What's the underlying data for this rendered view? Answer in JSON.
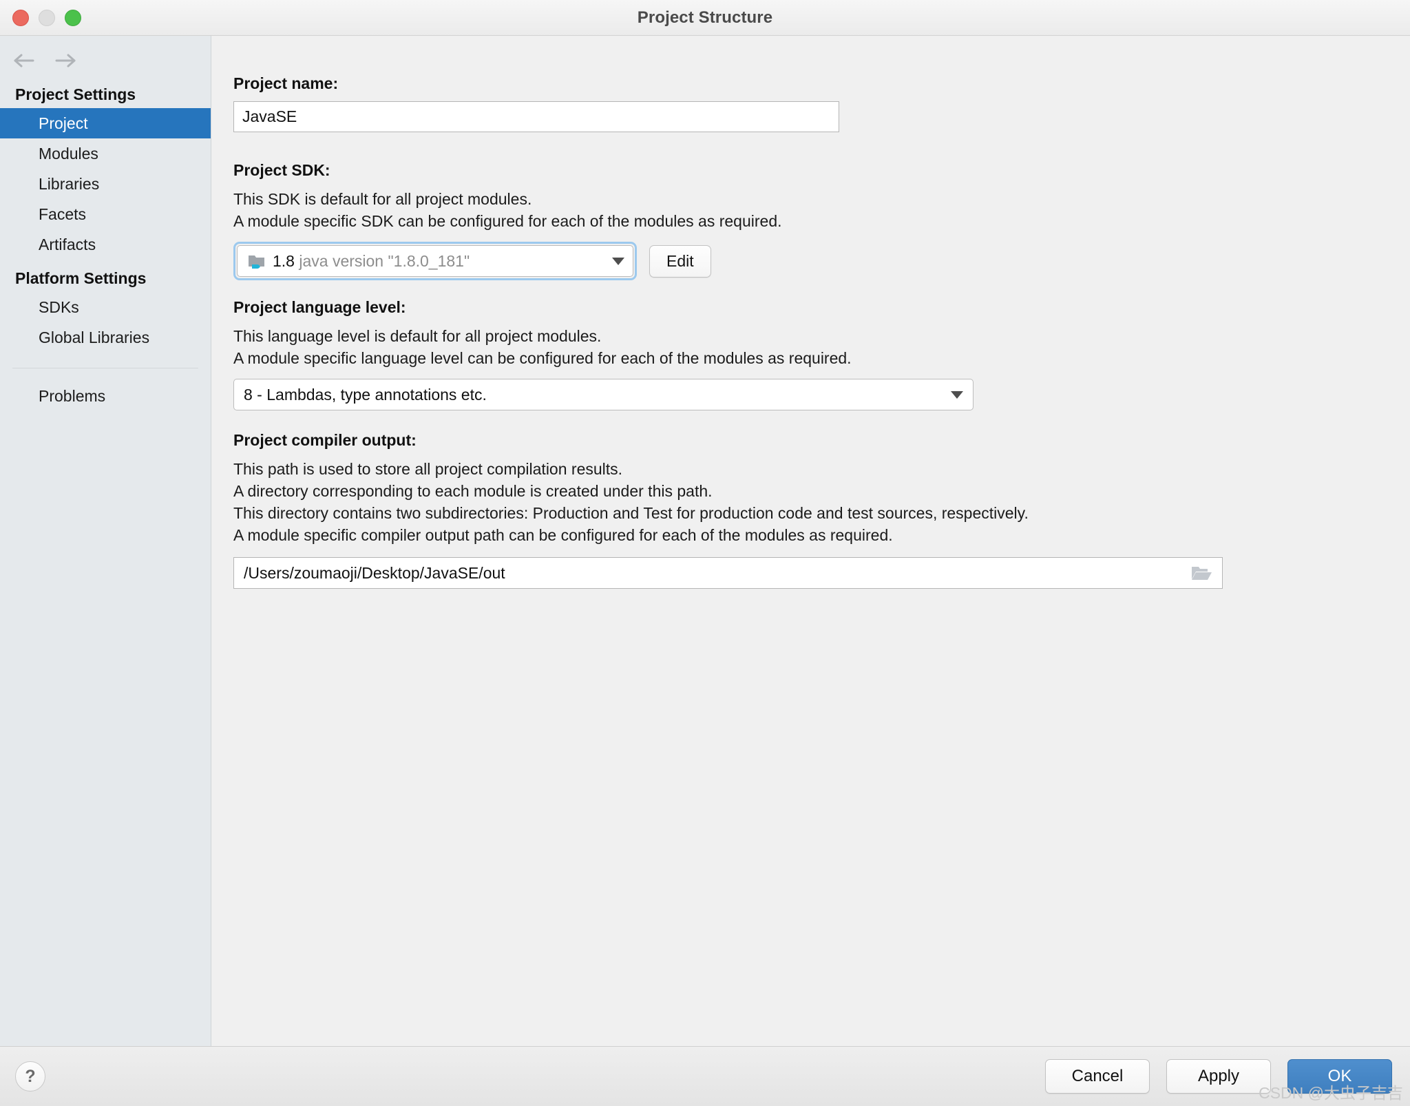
{
  "window": {
    "title": "Project Structure",
    "traffic_lights": [
      "close",
      "minimize",
      "zoom"
    ]
  },
  "sidebar": {
    "nav": {
      "back_icon": "arrow-left-icon",
      "forward_icon": "arrow-right-icon"
    },
    "groups": [
      {
        "title": "Project Settings",
        "items": [
          {
            "label": "Project",
            "selected": true
          },
          {
            "label": "Modules",
            "selected": false
          },
          {
            "label": "Libraries",
            "selected": false
          },
          {
            "label": "Facets",
            "selected": false
          },
          {
            "label": "Artifacts",
            "selected": false
          }
        ]
      },
      {
        "title": "Platform Settings",
        "items": [
          {
            "label": "SDKs",
            "selected": false
          },
          {
            "label": "Global Libraries",
            "selected": false
          }
        ]
      }
    ],
    "problems_item": {
      "label": "Problems"
    }
  },
  "main": {
    "project_name": {
      "label": "Project name:",
      "value": "JavaSE",
      "placeholder": ""
    },
    "project_sdk": {
      "label": "Project SDK:",
      "description": [
        "This SDK is default for all project modules.",
        "A module specific SDK can be configured for each of the modules as required."
      ],
      "selected_version": "1.8",
      "selected_detail": "java version \"1.8.0_181\"",
      "icon": "java-sdk-folder-icon",
      "caret_icon": "chevron-down-icon",
      "edit_label": "Edit"
    },
    "language_level": {
      "label": "Project language level:",
      "description": [
        "This language level is default for all project modules.",
        "A module specific language level can be configured for each of the modules as required."
      ],
      "value": "8 - Lambdas, type annotations etc.",
      "caret_icon": "chevron-down-icon"
    },
    "compiler_output": {
      "label": "Project compiler output:",
      "description": [
        "This path is used to store all project compilation results.",
        "A directory corresponding to each module is created under this path.",
        "This directory contains two subdirectories: Production and Test for production code and test sources, respectively.",
        "A module specific compiler output path can be configured for each of the modules as required."
      ],
      "path": "/Users/zoumaoji/Desktop/JavaSE/out",
      "browse_icon": "folder-open-icon"
    }
  },
  "footer": {
    "help_label": "?",
    "cancel_label": "Cancel",
    "apply_label": "Apply",
    "ok_label": "OK"
  },
  "watermark": "CSDN @大虫子吉吉",
  "colors": {
    "accent_selection": "#2675bd",
    "primary_button": "#4480c6",
    "sidebar_bg": "#e5e9ec",
    "main_bg": "#f0f0f0",
    "focus_ring": "#9cc9ee"
  }
}
